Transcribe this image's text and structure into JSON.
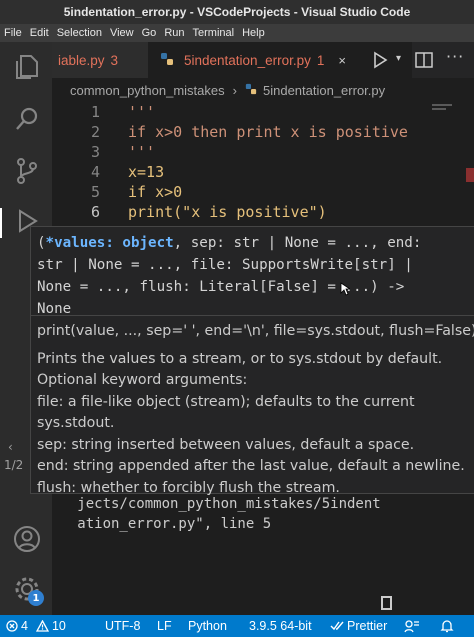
{
  "window": {
    "title": "5indentation_error.py - VSCodeProjects - Visual Studio Code"
  },
  "menu": [
    "File",
    "Edit",
    "Selection",
    "View",
    "Go",
    "Run",
    "Terminal",
    "Help"
  ],
  "tabs": [
    {
      "label": "iable.py",
      "badge": "3",
      "active": false
    },
    {
      "label": "5indentation_error.py",
      "badge": "1",
      "active": true,
      "close": "×"
    }
  ],
  "editor_actions": {
    "more": "···"
  },
  "breadcrumb": {
    "folder": "common_python_mistakes",
    "separator": "›",
    "file": "5indentation_error.py",
    "py_icon": "⬢"
  },
  "code_lines": [
    {
      "num": "1",
      "text": "'''"
    },
    {
      "num": "2",
      "text": "if x>0 then print x is positive"
    },
    {
      "num": "3",
      "text": "'''"
    },
    {
      "num": "4",
      "text": "x=13"
    },
    {
      "num": "5",
      "text": "if x>0"
    },
    {
      "num": "6",
      "text": "print(\"x is positive\")"
    }
  ],
  "hover": {
    "signature_lines": [
      "(*values: object, sep: str | None = ..., end:",
      "str | None = ..., file: SupportsWrite[str] |",
      "None = ..., flush: Literal[False] = ...) ->",
      "None"
    ],
    "signature_bold": "*values: object",
    "doc": {
      "call": "print(value, ..., sep=' ', end='\\n', file=sys.stdout, flush=False)",
      "lines": [
        "Prints the values to a stream, or to sys.stdout by default.",
        "Optional keyword arguments:",
        "file: a file-like object (stream); defaults to the current",
        "sys.stdout.",
        "sep: string inserted between values, default a space.",
        "end: string appended after the last value, default a newline.",
        "flush: whether to forcibly flush the stream."
      ]
    },
    "pager": "1/2"
  },
  "terminal_lines": [
    "   jects/common_python_mistakes/5indent",
    "   ation_error.py\", line 5"
  ],
  "status": {
    "errors": "4",
    "warnings": "10",
    "encoding": "UTF-8",
    "eol": "LF",
    "language": "Python",
    "interpreter": "3.9.5 64-bit",
    "prettier": "Prettier"
  },
  "settings_badge": "1",
  "colors": {
    "statusbar": "#007acc",
    "error_tab": "#e2725b",
    "editor_bg": "#1e1e1e"
  }
}
